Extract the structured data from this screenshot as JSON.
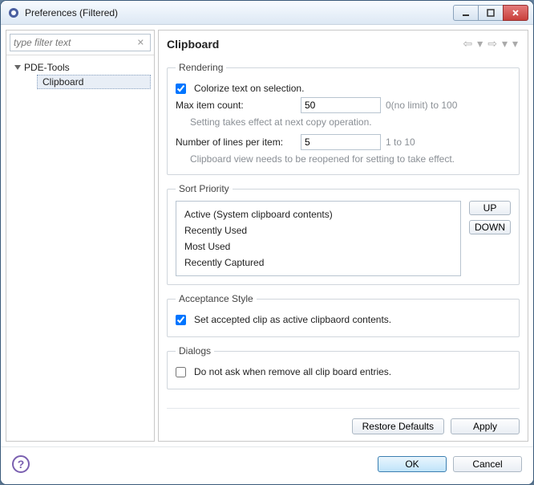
{
  "window": {
    "title": "Preferences (Filtered)"
  },
  "sidebar": {
    "filter_placeholder": "type filter text",
    "items": [
      {
        "label": "PDE-Tools",
        "children": [
          {
            "label": "Clipboard",
            "selected": true
          }
        ]
      }
    ]
  },
  "main": {
    "heading": "Clipboard",
    "rendering": {
      "legend": "Rendering",
      "colorize_label": "Colorize text on selection.",
      "colorize_checked": true,
      "max_item_label": "Max item count:",
      "max_item_value": "50",
      "max_item_hint": "0(no limit) to 100",
      "max_item_note": "Setting takes effect at next copy operation.",
      "lines_label": "Number of lines per item:",
      "lines_value": "5",
      "lines_hint": "1 to 10",
      "lines_note": "Clipboard view needs to be reopened for setting to take effect."
    },
    "sort": {
      "legend": "Sort Priority",
      "items": [
        "Active (System clipboard contents)",
        "Recently Used",
        "Most Used",
        "Recently Captured"
      ],
      "up_label": "UP",
      "down_label": "DOWN"
    },
    "acceptance": {
      "legend": "Acceptance Style",
      "label": "Set accepted clip as active clipbaord contents.",
      "checked": true
    },
    "dialogs": {
      "legend": "Dialogs",
      "label": "Do not ask when remove all clip board entries.",
      "checked": false
    },
    "restore_label": "Restore Defaults",
    "apply_label": "Apply"
  },
  "footer": {
    "ok_label": "OK",
    "cancel_label": "Cancel"
  }
}
